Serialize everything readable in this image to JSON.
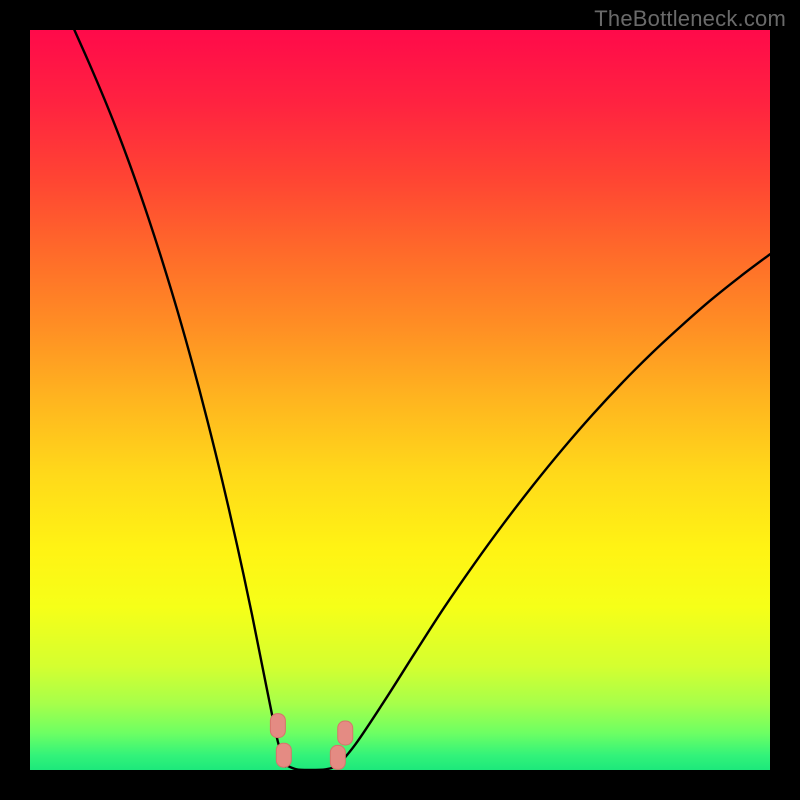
{
  "watermark": "TheBottleneck.com",
  "colors": {
    "gradient_stops": [
      {
        "offset": 0.0,
        "color": "#ff0a4a"
      },
      {
        "offset": 0.1,
        "color": "#ff2340"
      },
      {
        "offset": 0.2,
        "color": "#ff4433"
      },
      {
        "offset": 0.3,
        "color": "#ff6a2a"
      },
      {
        "offset": 0.4,
        "color": "#ff8e24"
      },
      {
        "offset": 0.5,
        "color": "#ffb51f"
      },
      {
        "offset": 0.6,
        "color": "#ffd91a"
      },
      {
        "offset": 0.7,
        "color": "#fff314"
      },
      {
        "offset": 0.78,
        "color": "#f6ff18"
      },
      {
        "offset": 0.86,
        "color": "#d4ff30"
      },
      {
        "offset": 0.91,
        "color": "#a7ff4a"
      },
      {
        "offset": 0.95,
        "color": "#6dff63"
      },
      {
        "offset": 0.98,
        "color": "#33f37a"
      },
      {
        "offset": 1.0,
        "color": "#1de87b"
      }
    ],
    "curve": "#000000",
    "marker_fill": "#e48b83",
    "marker_stroke": "#d6746c",
    "frame": "#000000"
  },
  "chart_data": {
    "type": "line",
    "title": "",
    "xlabel": "",
    "ylabel": "",
    "xlim": [
      0,
      100
    ],
    "ylim": [
      0,
      100
    ],
    "grid": false,
    "legend": false,
    "series": [
      {
        "name": "left-branch",
        "x": [
          6,
          8,
          10,
          12,
          14,
          16,
          18,
          20,
          22,
          24,
          26,
          28,
          30,
          32,
          33.5,
          34.5
        ],
        "y": [
          100,
          95.5,
          90.8,
          85.8,
          80.4,
          74.6,
          68.4,
          61.8,
          54.7,
          47.1,
          39.0,
          30.3,
          21.0,
          11.0,
          3.8,
          0.7
        ]
      },
      {
        "name": "valley",
        "x": [
          34.5,
          36,
          38,
          40,
          41.5
        ],
        "y": [
          0.7,
          0.1,
          0.0,
          0.1,
          0.5
        ]
      },
      {
        "name": "right-branch",
        "x": [
          41.5,
          44,
          48,
          52,
          56,
          60,
          64,
          68,
          72,
          76,
          80,
          84,
          88,
          92,
          96,
          100
        ],
        "y": [
          0.5,
          3.5,
          9.5,
          15.8,
          22.0,
          27.8,
          33.3,
          38.5,
          43.4,
          48.0,
          52.3,
          56.3,
          60.0,
          63.5,
          66.7,
          69.7
        ]
      }
    ],
    "markers": [
      {
        "name": "left-marker-upper",
        "x": 33.5,
        "y": 6.0
      },
      {
        "name": "left-marker-lower",
        "x": 34.3,
        "y": 2.0
      },
      {
        "name": "right-marker-upper",
        "x": 42.6,
        "y": 5.0
      },
      {
        "name": "right-marker-lower",
        "x": 41.6,
        "y": 1.7
      }
    ]
  }
}
